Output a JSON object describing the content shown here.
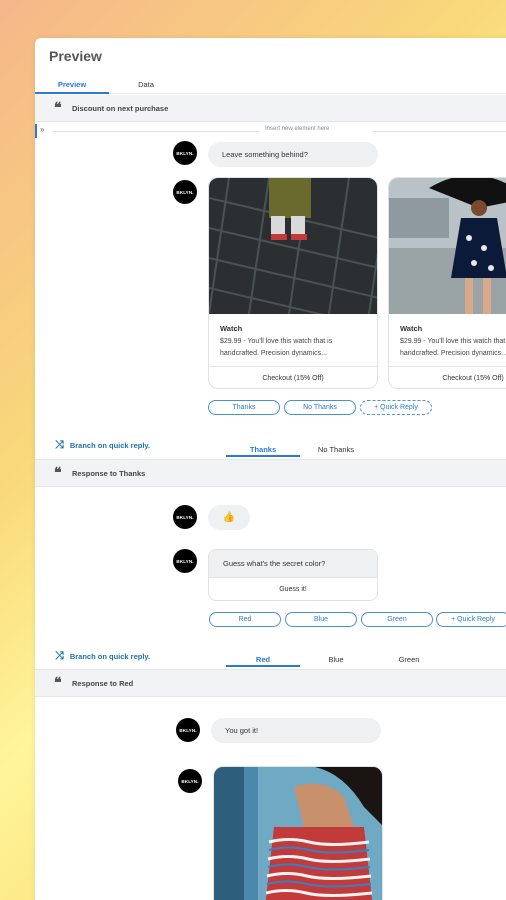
{
  "panel": {
    "title": "Preview"
  },
  "tabs": [
    {
      "label": "Preview"
    },
    {
      "label": "Data"
    }
  ],
  "sections": {
    "discount": {
      "label": "Discount on next purchase"
    },
    "thanks": {
      "label": "Response to Thanks"
    },
    "red": {
      "label": "Response to Red"
    }
  },
  "insert": {
    "text": "Insert new element here"
  },
  "avatar_text": "BKLYN.",
  "message1": {
    "text": "Leave something behind?"
  },
  "cards": [
    {
      "title": "Watch",
      "desc": "$29.99 - You'll love this watch that is handcrafted. Precision dynamics...",
      "button": "Checkout (15% Off)"
    },
    {
      "title": "Watch",
      "desc": "$29.99 - You'll love this watch that is handcrafted. Precision dynamics...",
      "button": "Checkout (15% Off)"
    }
  ],
  "quick_replies_1": [
    "Thanks",
    "No Thanks",
    "+ Quick Reply"
  ],
  "branch1": {
    "label": "Branch on quick reply.",
    "tabs": [
      "Thanks",
      "No Thanks"
    ]
  },
  "thanks_emoji": "👍",
  "secret": {
    "question": "Guess what's the secret color?",
    "button": "Guess it!"
  },
  "quick_replies_2": [
    "Red",
    "Blue",
    "Green",
    "+ Quick Reply"
  ],
  "branch2": {
    "label": "Branch on quick reply.",
    "tabs": [
      "Red",
      "Blue",
      "Green"
    ]
  },
  "message_red": {
    "text": "You got it!"
  },
  "colors": {
    "accent": "#2a7ad6",
    "branch": "#1a73a8",
    "bubble": "#eef0f2"
  }
}
